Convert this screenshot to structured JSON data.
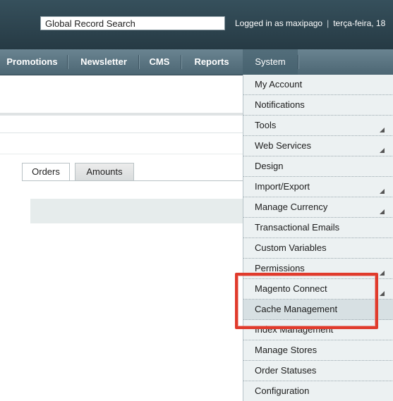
{
  "header": {
    "search_value": "Global Record Search",
    "logged_in_text": "Logged in as maxipago",
    "date_text": "terça-feira, 18"
  },
  "nav": {
    "items": [
      {
        "label": "Promotions"
      },
      {
        "label": "Newsletter"
      },
      {
        "label": "CMS"
      },
      {
        "label": "Reports"
      },
      {
        "label": "System"
      }
    ]
  },
  "tabs": [
    {
      "label": "Orders"
    },
    {
      "label": "Amounts"
    }
  ],
  "system_menu": {
    "items": [
      {
        "label": "My Account",
        "has_submenu": false
      },
      {
        "label": "Notifications",
        "has_submenu": false
      },
      {
        "label": "Tools",
        "has_submenu": true
      },
      {
        "label": "Web Services",
        "has_submenu": true
      },
      {
        "label": "Design",
        "has_submenu": false
      },
      {
        "label": "Import/Export",
        "has_submenu": true
      },
      {
        "label": "Manage Currency",
        "has_submenu": true
      },
      {
        "label": "Transactional Emails",
        "has_submenu": false
      },
      {
        "label": "Custom Variables",
        "has_submenu": false
      },
      {
        "label": "Permissions",
        "has_submenu": true
      },
      {
        "label": "Magento Connect",
        "has_submenu": true
      },
      {
        "label": "Cache Management",
        "has_submenu": false
      },
      {
        "label": "Index Management",
        "has_submenu": false
      },
      {
        "label": "Manage Stores",
        "has_submenu": false
      },
      {
        "label": "Order Statuses",
        "has_submenu": false
      },
      {
        "label": "Configuration",
        "has_submenu": false
      }
    ]
  },
  "colors": {
    "header_bg": "#2e4550",
    "nav_bg": "#5b7582",
    "menu_bg": "#ecf1f2",
    "highlight": "#e03b2c"
  }
}
